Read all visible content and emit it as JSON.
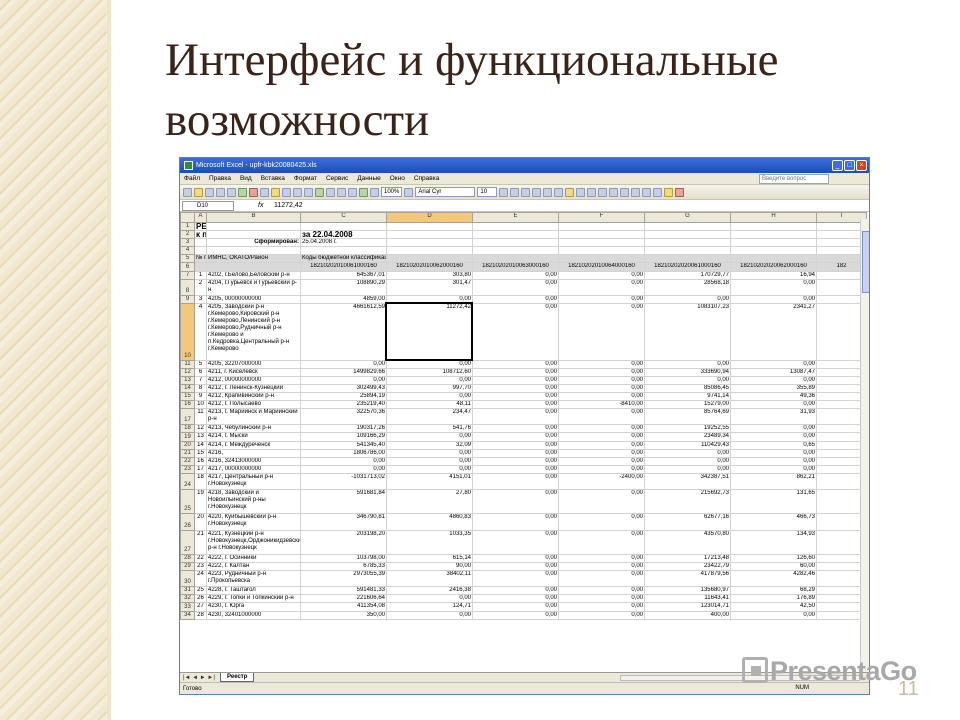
{
  "slide": {
    "title_line1": "Интерфейс и функциональные",
    "title_line2": "возможности",
    "page_number": "11",
    "watermark": "PresentaGo"
  },
  "excel": {
    "window_title": "Microsoft Excel - upfr-kbk20080425.xls",
    "menu": [
      "Файл",
      "Правка",
      "Вид",
      "Вставка",
      "Формат",
      "Сервис",
      "Данные",
      "Окно",
      "Справка"
    ],
    "help_placeholder": "Введите вопрос",
    "zoom": "100%",
    "font_name": "Arial Cyr",
    "font_size": "10",
    "name_box": "D10",
    "fx_label": "fx",
    "formula_value": "11272,42",
    "columns": [
      "A",
      "B",
      "C",
      "D",
      "E",
      "F",
      "G",
      "H",
      "I"
    ],
    "sheet_tab": "Реестр",
    "sheet_nav": "|◄ ◄ ► ►|",
    "status_left": "Готово",
    "status_num": "NUM",
    "rows": [
      {
        "n": "1",
        "cells": [
          "РЕЕСТР",
          "",
          "",
          "",
          "",
          "",
          "",
          "",
          ""
        ]
      },
      {
        "n": "2",
        "cells": [
          "к платежному поручению",
          "",
          "за 22.04.2008",
          "",
          "",
          "",
          "",
          "",
          ""
        ]
      },
      {
        "n": "3",
        "cells": [
          "",
          "Сформирован:",
          "25.04.2008 г.",
          "",
          "",
          "",
          "",
          "",
          ""
        ]
      },
      {
        "n": "4",
        "cells": [
          "",
          "",
          "",
          "",
          "",
          "",
          "",
          "",
          ""
        ]
      },
      {
        "n": "5",
        "cells": [
          "№ п/п",
          "ИМНС, ОКАТО/Район",
          "Коды бюджетной классификации",
          "",
          "",
          "",
          "",
          "",
          ""
        ]
      },
      {
        "n": "6",
        "cells": [
          "",
          "",
          "18210202010061000160",
          "18210202010062000160",
          "18210202010063000160",
          "18210202010064000160",
          "18210202020061000160",
          "18210202020062000160",
          "182"
        ]
      },
      {
        "n": "7",
        "cells": [
          "1",
          "4202, г.Белово,Беловский р-н",
          "645367,01",
          "303,80",
          "0,00",
          "0,00",
          "170729,77",
          "16,94",
          ""
        ]
      },
      {
        "n": "8",
        "cells": [
          "2",
          "4204, г.Гурьевск и Гурьевский р-н",
          "108890,29",
          "301,47",
          "0,00",
          "0,00",
          "28568,18",
          "0,00",
          ""
        ]
      },
      {
        "n": "9",
        "cells": [
          "3",
          "4205, 00000000000",
          "4859,00",
          "0,00",
          "0,00",
          "0,00",
          "0,00",
          "0,00",
          ""
        ]
      },
      {
        "n": "10",
        "cells": [
          "4",
          "4205, Заводский р-н г.Кемерово,Кировский р-н г.Кемерово,Ленинский р-н г.Кемерово,Рудничный р-н г.Кемерово и п.Кедровка,Центральный р-н г.Кемерово",
          "4661612,59",
          "11272,42",
          "0,00",
          "0,00",
          "1083107,23",
          "2341,27",
          ""
        ]
      },
      {
        "n": "11",
        "cells": [
          "5",
          "4205, 32207000000",
          "0,00",
          "0,00",
          "0,00",
          "0,00",
          "0,00",
          "0,00",
          ""
        ]
      },
      {
        "n": "12",
        "cells": [
          "6",
          "4211, г. Киселевск",
          "1499829,66",
          "108712,60",
          "0,00",
          "0,00",
          "333690,94",
          "13087,47",
          ""
        ]
      },
      {
        "n": "13",
        "cells": [
          "7",
          "4212, 00000000000",
          "0,00",
          "0,00",
          "0,00",
          "0,00",
          "0,00",
          "0,00",
          ""
        ]
      },
      {
        "n": "14",
        "cells": [
          "8",
          "4212, г. Ленинск-Кузнецкий",
          "302499,43",
          "997,70",
          "0,00",
          "0,00",
          "85086,45",
          "355,89",
          ""
        ]
      },
      {
        "n": "15",
        "cells": [
          "9",
          "4212, Крапивинский р-н",
          "25894,19",
          "0,00",
          "0,00",
          "0,00",
          "9741,14",
          "49,36",
          ""
        ]
      },
      {
        "n": "16",
        "cells": [
          "10",
          "4212, г. Полысаево",
          "235219,40",
          "48,11",
          "0,00",
          "-8410,00",
          "15279,00",
          "0,00",
          ""
        ]
      },
      {
        "n": "17",
        "cells": [
          "11",
          "4213, г. Мариинск и Мариинский р-н",
          "322570,36",
          "234,47",
          "0,00",
          "0,00",
          "85764,69",
          "31,93",
          ""
        ]
      },
      {
        "n": "18",
        "cells": [
          "12",
          "4213, Чебулинский р-н",
          "190317,26",
          "541,76",
          "0,00",
          "0,00",
          "19252,55",
          "0,00",
          ""
        ]
      },
      {
        "n": "19",
        "cells": [
          "13",
          "4214, г. Мыски",
          "109166,29",
          "0,00",
          "0,00",
          "0,00",
          "23489,34",
          "0,00",
          ""
        ]
      },
      {
        "n": "20",
        "cells": [
          "14",
          "4214, г. Междуреченск",
          "541345,40",
          "32,09",
          "0,00",
          "0,00",
          "110429,43",
          "0,65",
          ""
        ]
      },
      {
        "n": "21",
        "cells": [
          "15",
          "4216,",
          "1806786,00",
          "0,00",
          "0,00",
          "0,00",
          "0,00",
          "0,00",
          ""
        ]
      },
      {
        "n": "22",
        "cells": [
          "16",
          "4216, 32413000000",
          "0,00",
          "0,00",
          "0,00",
          "0,00",
          "0,00",
          "0,00",
          ""
        ]
      },
      {
        "n": "23",
        "cells": [
          "17",
          "4217, 00000000000",
          "0,00",
          "0,00",
          "0,00",
          "0,00",
          "0,00",
          "0,00",
          ""
        ]
      },
      {
        "n": "24",
        "cells": [
          "18",
          "4217, Центральный р-н г.Новокузнецк",
          "-1031713,02",
          "4151,01",
          "0,00",
          "-2400,00",
          "342387,51",
          "862,21",
          ""
        ]
      },
      {
        "n": "25",
        "cells": [
          "19",
          "4218, Заводский и Новоильинский р-ны г.Новокузнецк",
          "591681,84",
          "27,80",
          "0,00",
          "0,00",
          "215692,73",
          "131,65",
          ""
        ]
      },
      {
        "n": "26",
        "cells": [
          "20",
          "4220, Куйбышевский р-н г.Новокузнецк",
          "346790,81",
          "4860,83",
          "0,00",
          "0,00",
          "62677,16",
          "466,73",
          ""
        ]
      },
      {
        "n": "27",
        "cells": [
          "21",
          "4221, Кузнецкий р-н г.Новокузнецк,Орджоникидзевский р-н г.Новокузнецк",
          "203198,20",
          "1033,35",
          "0,00",
          "0,00",
          "43570,80",
          "134,93",
          ""
        ]
      },
      {
        "n": "28",
        "cells": [
          "22",
          "4222, г. Осинники",
          "103798,00",
          "615,14",
          "0,00",
          "0,00",
          "17213,48",
          "126,60",
          ""
        ]
      },
      {
        "n": "29",
        "cells": [
          "23",
          "4222, г. Калтан",
          "6785,33",
          "90,00",
          "0,00",
          "0,00",
          "23422,79",
          "60,00",
          ""
        ]
      },
      {
        "n": "30",
        "cells": [
          "24",
          "4223, Рудничный р-н г.Прокопьевска",
          "2973055,39",
          "38402,11",
          "0,00",
          "0,00",
          "417879,56",
          "4282,46",
          ""
        ]
      },
      {
        "n": "31",
        "cells": [
          "25",
          "4228, г. Таштагол",
          "591481,33",
          "2416,38",
          "0,00",
          "0,00",
          "135680,97",
          "68,29",
          ""
        ]
      },
      {
        "n": "32",
        "cells": [
          "26",
          "4229, г. Топки и Топкинский р-н",
          "221606,64",
          "0,00",
          "0,00",
          "0,00",
          "11643,41",
          "176,89",
          ""
        ]
      },
      {
        "n": "33",
        "cells": [
          "27",
          "4230, г. Юрга",
          "411354,08",
          "124,71",
          "0,00",
          "0,00",
          "123014,71",
          "42,50",
          ""
        ]
      },
      {
        "n": "34",
        "cells": [
          "28",
          "4230, 32401000000",
          "350,00",
          "0,00",
          "0,00",
          "0,00",
          "400,00",
          "0,00",
          ""
        ]
      }
    ]
  }
}
